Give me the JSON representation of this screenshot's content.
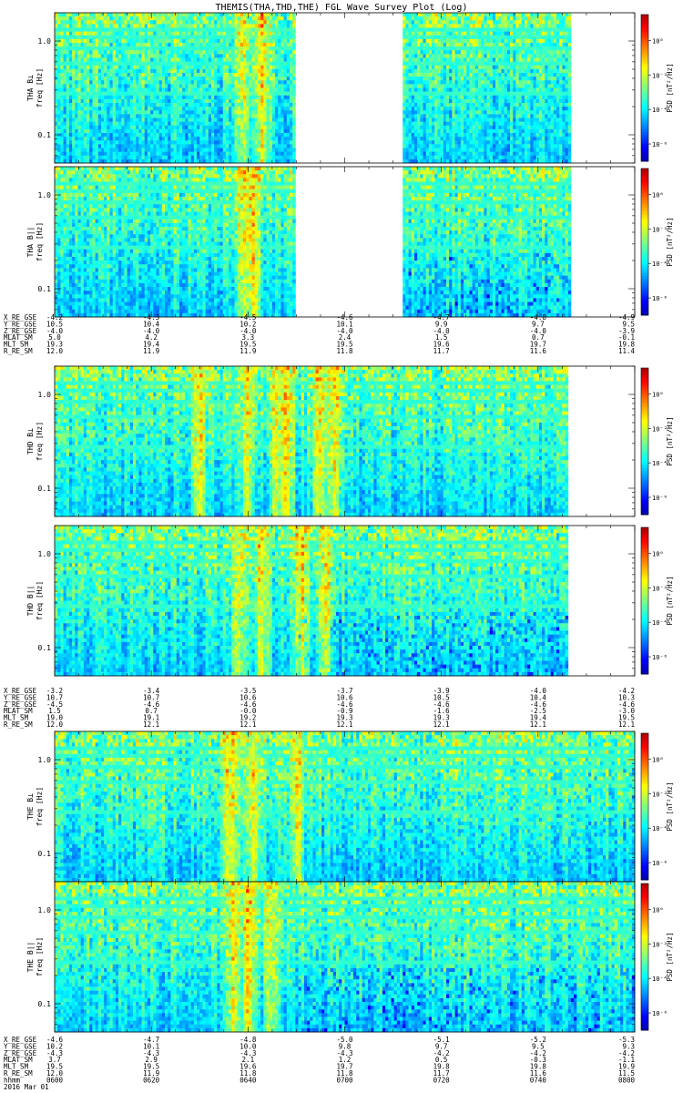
{
  "title": "THEMIS(THA,THD,THE) FGL Wave Survey Plot (Log)",
  "freq_label": "freq [Hz]",
  "psd_label": "PSD [nT²/Hz]",
  "freq_ticks": [
    {
      "value": 1.0,
      "label": "1.0"
    },
    {
      "value": 0.1,
      "label": "0.1"
    }
  ],
  "colorbar_ticks": [
    {
      "value": 0,
      "label": "10⁰"
    },
    {
      "value": -2,
      "label": "10⁻²"
    },
    {
      "value": -4,
      "label": "10⁻⁴"
    },
    {
      "value": -6,
      "label": "10⁻⁶"
    }
  ],
  "time_labels": [
    "0600",
    "0620",
    "0640",
    "0700",
    "0720",
    "0740",
    "0800"
  ],
  "date_label": "2016 Mar 01",
  "hhmm_label": "hhmm",
  "chart_data": [
    {
      "type": "heatmap",
      "name": "THA B⊥",
      "ylabel_line1": "THA B⊥",
      "xlim_hhmm": [
        "0600",
        "0800"
      ],
      "ylim_hz": [
        0.05,
        2.0
      ],
      "yscale": "log",
      "colorscale_log10": [
        -7,
        1.5
      ],
      "data_gap_hhmm": [
        "0650",
        "0712"
      ],
      "data_end_hhmm": "0747",
      "bright_minutes": [
        39,
        43,
        52,
        60,
        63
      ]
    },
    {
      "type": "heatmap",
      "name": "THA B||",
      "ylabel_line1": "THA B||",
      "xlim_hhmm": [
        "0600",
        "0800"
      ],
      "ylim_hz": [
        0.05,
        2.0
      ],
      "yscale": "log",
      "colorscale_log10": [
        -7,
        1.5
      ],
      "data_gap_hhmm": [
        "0650",
        "0712"
      ],
      "data_end_hhmm": "0747",
      "bright_minutes": [
        39,
        41,
        53,
        55
      ]
    },
    {
      "type": "heatmap",
      "name": "THD B⊥",
      "ylabel_line1": "THD B⊥",
      "xlim_hhmm": [
        "0600",
        "0800"
      ],
      "ylim_hz": [
        0.05,
        2.0
      ],
      "yscale": "log",
      "colorscale_log10": [
        -7,
        1.5
      ],
      "data_end_hhmm": "0746",
      "bright_minutes": [
        30,
        40,
        46,
        48,
        55,
        58
      ]
    },
    {
      "type": "heatmap",
      "name": "THD B||",
      "ylabel_line1": "THD B||",
      "xlim_hhmm": [
        "0600",
        "0800"
      ],
      "ylim_hz": [
        0.05,
        2.0
      ],
      "yscale": "log",
      "colorscale_log10": [
        -7,
        1.5
      ],
      "data_end_hhmm": "0746",
      "bright_minutes": [
        38,
        43,
        51,
        56
      ]
    },
    {
      "type": "heatmap",
      "name": "THE B⊥",
      "ylabel_line1": "THE B⊥",
      "xlim_hhmm": [
        "0600",
        "0800"
      ],
      "ylim_hz": [
        0.05,
        2.0
      ],
      "yscale": "log",
      "colorscale_log10": [
        -7,
        1.5
      ],
      "bright_minutes": [
        36,
        37,
        41,
        50
      ]
    },
    {
      "type": "heatmap",
      "name": "THE B||",
      "ylabel_line1": "THE B||",
      "xlim_hhmm": [
        "0600",
        "0800"
      ],
      "ylim_hz": [
        0.05,
        2.0
      ],
      "yscale": "log",
      "colorscale_log10": [
        -7,
        1.5
      ],
      "bright_minutes": [
        37,
        40,
        45
      ]
    }
  ],
  "ephemeris_blocks": [
    {
      "rows": [
        {
          "label": "X_RE_GSE",
          "values": [
            "-4.2",
            "-4.3",
            "-4.5",
            "-4.6",
            "-4.7",
            "-4.8",
            "-4.9"
          ]
        },
        {
          "label": "Y_RE_GSE",
          "values": [
            "10.5",
            "10.4",
            "10.2",
            "10.1",
            "9.9",
            "9.7",
            "9.5"
          ]
        },
        {
          "label": "Z_RE_GSE",
          "values": [
            "-4.0",
            "-4.0",
            "-4.0",
            "-4.0",
            "-4.0",
            "-4.0",
            "-3.9"
          ]
        },
        {
          "label": "MLAT_SM",
          "values": [
            "5.0",
            "4.2",
            "3.3",
            "2.4",
            "1.5",
            "0.7",
            "-0.1"
          ]
        },
        {
          "label": "MLT_SM",
          "values": [
            "19.3",
            "19.4",
            "19.5",
            "19.5",
            "19.6",
            "19.7",
            "19.8"
          ]
        },
        {
          "label": "R_RE_SM",
          "values": [
            "12.0",
            "11.9",
            "11.9",
            "11.8",
            "11.7",
            "11.6",
            "11.4"
          ]
        }
      ]
    },
    {
      "rows": [
        {
          "label": "X_RE_GSE",
          "values": [
            "-3.2",
            "-3.4",
            "-3.5",
            "-3.7",
            "-3.9",
            "-4.0",
            "-4.2"
          ]
        },
        {
          "label": "Y_RE_GSE",
          "values": [
            "10.7",
            "10.7",
            "10.6",
            "10.6",
            "10.5",
            "10.4",
            "10.3"
          ]
        },
        {
          "label": "Z_RE_GSE",
          "values": [
            "-4.5",
            "-4.6",
            "-4.6",
            "-4.6",
            "-4.6",
            "-4.6",
            "-4.6"
          ]
        },
        {
          "label": "MLAT_SM",
          "values": [
            "1.5",
            "0.7",
            "-0.0",
            "-0.9",
            "-1.6",
            "-2.5",
            "-3.0"
          ]
        },
        {
          "label": "MLT_SM",
          "values": [
            "19.0",
            "19.1",
            "19.2",
            "19.3",
            "19.3",
            "19.4",
            "19.5"
          ]
        },
        {
          "label": "R_RE_SM",
          "values": [
            "12.0",
            "12.1",
            "12.1",
            "12.1",
            "12.1",
            "12.1",
            "12.1"
          ]
        }
      ]
    },
    {
      "rows": [
        {
          "label": "X_RE_GSE",
          "values": [
            "-4.6",
            "-4.7",
            "-4.8",
            "-5.0",
            "-5.1",
            "-5.2",
            "-5.3"
          ]
        },
        {
          "label": "Y_RE_GSE",
          "values": [
            "10.2",
            "10.1",
            "10.0",
            "9.8",
            "9.7",
            "9.5",
            "9.3"
          ]
        },
        {
          "label": "Z_RE_GSE",
          "values": [
            "-4.3",
            "-4.3",
            "-4.3",
            "-4.3",
            "-4.2",
            "-4.2",
            "-4.2"
          ]
        },
        {
          "label": "MLAT_SM",
          "values": [
            "3.7",
            "2.9",
            "2.1",
            "1.2",
            "0.5",
            "-0.3",
            "-1.1"
          ]
        },
        {
          "label": "MLT_SM",
          "values": [
            "19.5",
            "19.5",
            "19.6",
            "19.7",
            "19.8",
            "19.8",
            "19.9"
          ]
        },
        {
          "label": "R_RE_SM",
          "values": [
            "12.0",
            "11.9",
            "11.8",
            "11.8",
            "11.7",
            "11.6",
            "11.5"
          ]
        }
      ]
    }
  ]
}
